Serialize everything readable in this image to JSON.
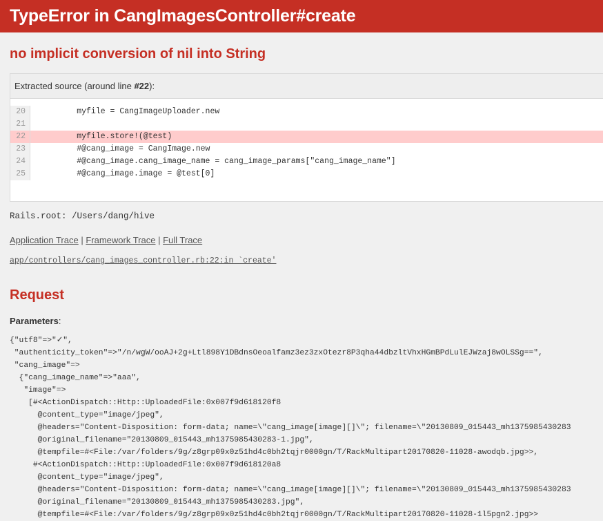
{
  "header": {
    "title": "TypeError in CangImagesController#create"
  },
  "error_message": "no implicit conversion of nil into String",
  "source": {
    "info_prefix": "Extracted source (around line ",
    "info_line": "#22",
    "info_suffix": "):",
    "line_numbers": [
      "20",
      "21",
      "22",
      "23",
      "24",
      "25"
    ],
    "lines": [
      "        myfile = CangImageUploader.new",
      "",
      "        myfile.store!(@test)",
      "        #@cang_image = CangImage.new",
      "        #@cang_image.cang_image_name = cang_image_params[\"cang_image_name\"]",
      "        #@cang_image.image = @test[0]"
    ]
  },
  "rails_root": "Rails.root: /Users/dang/hive",
  "trace": {
    "application": "Application Trace",
    "framework": "Framework Trace",
    "full": "Full Trace",
    "separator": " | ",
    "file": "app/controllers/cang_images_controller.rb:22:in `create'"
  },
  "request": {
    "heading": "Request",
    "params_label": "Parameters",
    "params_colon": ":",
    "params_text": "{\"utf8\"=>\"✓\",\n \"authenticity_token\"=>\"/n/wgW/ooAJ+2g+Ltl898Y1DBdnsOeoalfamz3ez3zxOtezr8P3qha44dbzltVhxHGmBPdLulEJWzaj8wOLSSg==\",\n \"cang_image\"=>\n  {\"cang_image_name\"=>\"aaa\",\n   \"image\"=>\n    [#<ActionDispatch::Http::UploadedFile:0x007f9d618120f8\n      @content_type=\"image/jpeg\",\n      @headers=\"Content-Disposition: form-data; name=\\\"cang_image[image][]\\\"; filename=\\\"20130809_015443_mh1375985430283\n      @original_filename=\"20130809_015443_mh1375985430283-1.jpg\",\n      @tempfile=#<File:/var/folders/9g/z8grp09x0z51hd4c0bh2tqjr0000gn/T/RackMultipart20170820-11028-awodqb.jpg>>,\n     #<ActionDispatch::Http::UploadedFile:0x007f9d618120a8\n      @content_type=\"image/jpeg\",\n      @headers=\"Content-Disposition: form-data; name=\\\"cang_image[image][]\\\"; filename=\\\"20130809_015443_mh1375985430283\n      @original_filename=\"20130809_015443_mh1375985430283.jpg\",\n      @tempfile=#<File:/var/folders/9g/z8grp09x0z51hd4c0bh2tqjr0000gn/T/RackMultipart20170820-11028-1l5pgn2.jpg>>"
  }
}
